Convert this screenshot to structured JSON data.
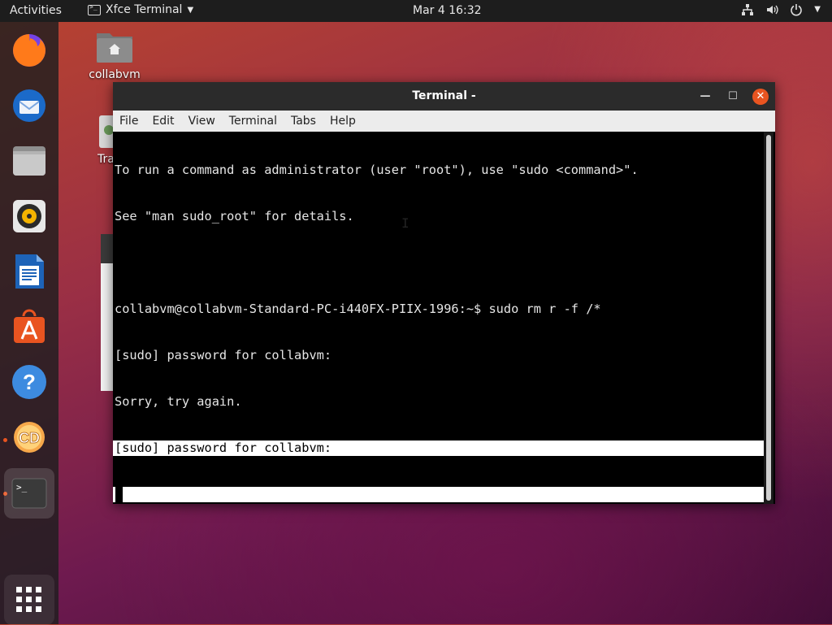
{
  "topbar": {
    "activities": "Activities",
    "app_name": "Xfce Terminal",
    "clock": "Mar 4  16:32"
  },
  "dock": {
    "items": [
      {
        "name": "Firefox",
        "icon": "firefox-icon"
      },
      {
        "name": "Thunderbird",
        "icon": "thunderbird-icon"
      },
      {
        "name": "Files",
        "icon": "files-icon"
      },
      {
        "name": "Rhythmbox",
        "icon": "rhythmbox-icon"
      },
      {
        "name": "LibreOffice Writer",
        "icon": "writer-icon"
      },
      {
        "name": "Ubuntu Software",
        "icon": "software-icon"
      },
      {
        "name": "Help",
        "icon": "help-icon",
        "glyph": "?"
      },
      {
        "name": "CD",
        "icon": "cd-icon",
        "glyph": "CD"
      },
      {
        "name": "Terminal",
        "icon": "terminal-icon",
        "glyph": ">_"
      }
    ],
    "show_apps_icon": "grid-icon"
  },
  "desktop": {
    "home_label": "collabvm",
    "trash_label": "Tra"
  },
  "terminal": {
    "title": "Terminal -",
    "menu": [
      "File",
      "Edit",
      "View",
      "Terminal",
      "Tabs",
      "Help"
    ],
    "lines": [
      "To run a command as administrator (user \"root\"), use \"sudo <command>\".",
      "See \"man sudo_root\" for details.",
      "",
      "collabvm@collabvm-Standard-PC-i440FX-PIIX-1996:~$ sudo rm r -f /*",
      "[sudo] password for collabvm:",
      "Sorry, try again.",
      "[sudo] password for collabvm:"
    ]
  },
  "colors": {
    "accent": "#e95420",
    "topbar": "#1d1d1d",
    "terminal_bg": "#000000"
  }
}
